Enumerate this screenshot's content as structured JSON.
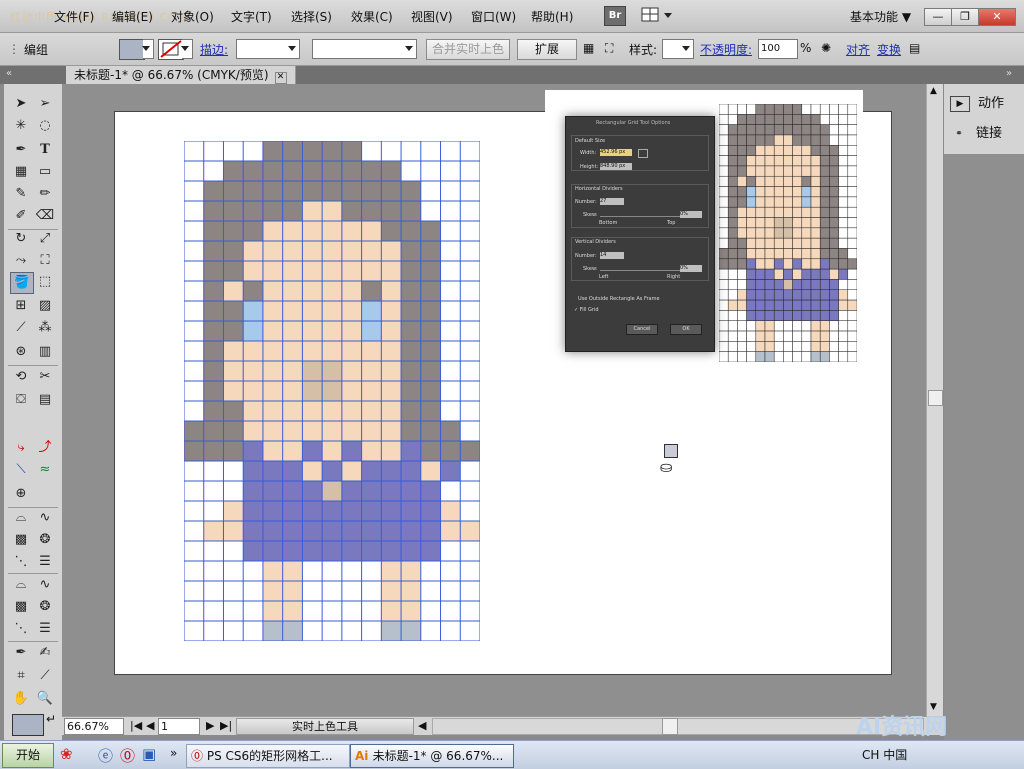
{
  "menubar": {
    "logo_text": "红动中国 WWW.REDOCN.COM",
    "items": [
      "文件(F)",
      "编辑(E)",
      "对象(O)",
      "文字(T)",
      "选择(S)",
      "效果(C)",
      "视图(V)",
      "窗口(W)",
      "帮助(H)"
    ],
    "bridge_label": "Br",
    "workspace_label": "基本功能 ▼",
    "window_controls": {
      "minimize": "—",
      "restore": "❐",
      "close": "✕"
    }
  },
  "control_bar": {
    "selection_label": "编组",
    "stroke_link": "描边:",
    "live_paint_button": "合并实时上色",
    "expand_button": "扩展",
    "style_label": "样式:",
    "opacity_link": "不透明度:",
    "opacity_value": "100",
    "opacity_unit": "%",
    "align_link": "对齐",
    "transform_link": "变换",
    "fill_color": "#aab4c4"
  },
  "document": {
    "tab_title": "未标题-1* @ 66.67% (CMYK/预览)",
    "tab_close": "✕"
  },
  "statusbar": {
    "zoom": "66.67%",
    "artboard": "1",
    "tool_name": "实时上色工具"
  },
  "right_panel": {
    "items": [
      {
        "label": "动作",
        "icon": "actions-play-icon"
      },
      {
        "label": "链接",
        "icon": "links-chain-icon"
      }
    ]
  },
  "dialog": {
    "title": "Rectangular Grid Tool Options",
    "default_size": "Default Size",
    "width_label": "Width:",
    "width_value": "452.96 px",
    "height_label": "Height:",
    "height_value": "848.90 px",
    "horizontal_dividers": "Horizontal Dividers",
    "h_number_label": "Number:",
    "h_number_value": "27",
    "skew_label": "Skew:",
    "h_skew_value": "0%",
    "bottom_label": "Bottom",
    "top_label": "Top",
    "vertical_dividers": "Vertical Dividers",
    "v_number_label": "Number:",
    "v_number_value": "14",
    "v_skew_value": "0%",
    "left_label": "Left",
    "right_label": "Right",
    "outside_rect": "Use Outside Rectangle As Frame",
    "fill_grid": "✓ Fill Grid",
    "cancel": "Cancel",
    "ok": "OK"
  },
  "taskbar": {
    "start": "开始",
    "tasks": [
      {
        "label": "PS CS6的矩形网格工..."
      },
      {
        "label": "未标题-1* @ 66.67%..."
      }
    ],
    "tray_text": "CH 中国",
    "watermark": "AI资讯网"
  },
  "colors": {
    "hair": "#8d8484",
    "skin": "#f6d8bc",
    "eye": "#a7c9ea",
    "dress": "#7a78bf",
    "shadow": "#d5bfa7",
    "shoe": "#b5c0cc",
    "grid_line": "#3b5bd8"
  }
}
